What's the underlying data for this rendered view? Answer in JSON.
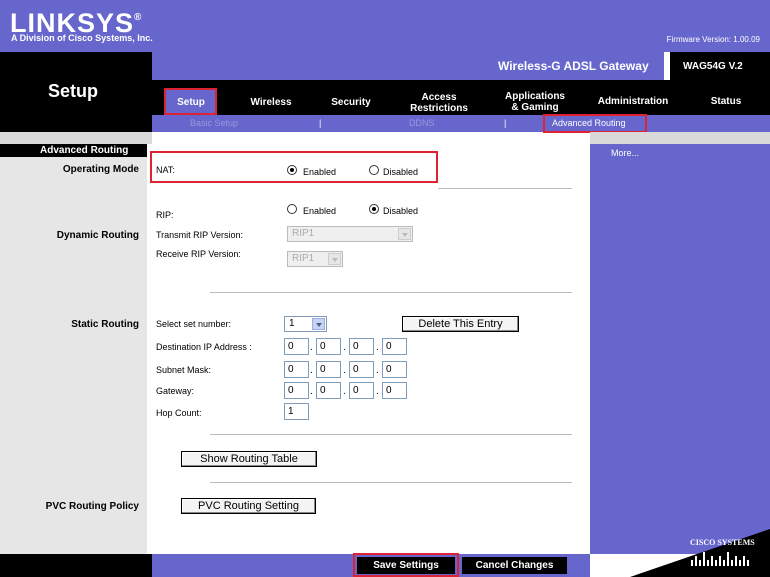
{
  "brand": {
    "logo": "LINKSYS",
    "registered": "®",
    "tagline": "A Division of Cisco Systems, Inc.",
    "firmware": "Firmware Version: 1.00.09",
    "product": "Wireless-G ADSL Gateway",
    "model": "WAG54G V.2",
    "cisco": "CISCO SYSTEMS"
  },
  "page_title": "Setup",
  "tabs": [
    {
      "label": "Setup",
      "active": true
    },
    {
      "label": "Wireless"
    },
    {
      "label": "Security"
    },
    {
      "label": "Access Restrictions",
      "line1": "Access",
      "line2": "Restrictions"
    },
    {
      "label": "Applications & Gaming",
      "line1": "Applications",
      "line2": "& Gaming"
    },
    {
      "label": "Administration"
    },
    {
      "label": "Status"
    }
  ],
  "subnav": {
    "items": [
      "Basic Setup",
      "DDNS",
      "Advanced Routing"
    ],
    "separator": "|",
    "active": "Advanced Routing"
  },
  "section_header": "Advanced Routing",
  "more_link": "More...",
  "sections": {
    "operating_mode": "Operating Mode",
    "dynamic_routing": "Dynamic Routing",
    "static_routing": "Static Routing",
    "pvc_routing_policy": "PVC Routing Policy"
  },
  "nat": {
    "label": "NAT:",
    "enabled": "Enabled",
    "disabled": "Disabled",
    "selected": "Enabled"
  },
  "rip": {
    "label": "RIP:",
    "enabled": "Enabled",
    "disabled": "Disabled",
    "selected": "Disabled",
    "transmit_label": "Transmit RIP Version:",
    "transmit_value": "RIP1",
    "receive_label": "Receive RIP Version:",
    "receive_value": "RIP1"
  },
  "static": {
    "set_label": "Select set number:",
    "set_value": "1",
    "delete_button": "Delete This Entry",
    "dest_label": "Destination IP Address :",
    "dest": [
      "0",
      "0",
      "0",
      "0"
    ],
    "mask_label": "Subnet Mask:",
    "mask": [
      "0",
      "0",
      "0",
      "0"
    ],
    "gateway_label": "Gateway:",
    "gateway": [
      "0",
      "0",
      "0",
      "0"
    ],
    "hop_label": "Hop Count:",
    "hop_value": "1",
    "show_table_button": "Show Routing Table"
  },
  "pvc": {
    "button": "PVC Routing Setting"
  },
  "footer": {
    "save": "Save Settings",
    "cancel": "Cancel Changes"
  },
  "colors": {
    "brand_purple": "#6666cc",
    "highlight_red": "#dd2233"
  }
}
